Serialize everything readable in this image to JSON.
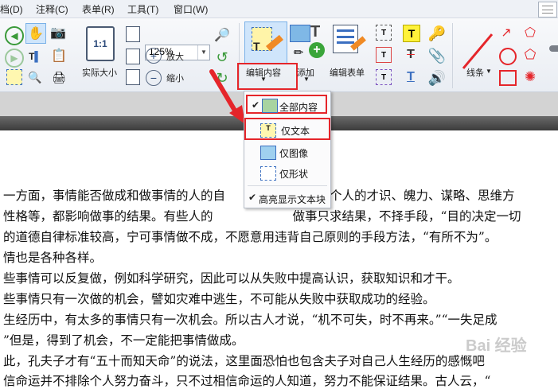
{
  "menubar": {
    "items": [
      "档(D)",
      "注释(C)",
      "表单(R)",
      "工具(T)",
      "窗口(W)"
    ]
  },
  "toolbar": {
    "zoom_value": "125%",
    "actual_size_label": "实际大小",
    "zoom_in_label": "放大",
    "zoom_out_label": "缩小",
    "edit_content_label": "编辑内容",
    "add_label": "添加",
    "edit_form_label": "编辑表单",
    "lines_label": "线条"
  },
  "dropdown": {
    "items": [
      {
        "label": "全部内容",
        "checked": true
      },
      {
        "label": "仅文本",
        "checked": false
      },
      {
        "label": "仅图像",
        "checked": false
      },
      {
        "label": "仅形状",
        "checked": false
      },
      {
        "label": "高亮显示文本块",
        "checked": true
      }
    ]
  },
  "document": {
    "lines": [
      "一方面，事情能否做成和做事情的人的自",
      "性格等，都影响做事的结果。有些人的",
      "的道德自律标准较高，宁可事情做不成，不愿意用违背自己原则的手段方法，“有所不为”。",
      "情也是各种各样。",
      "些事情可以反复做，例如科学研究，因此可以从失败中提高认识，获取知识和才干。",
      "些事情只有一次做的机会，譬如灾难中逃生，不可能从失败中获取成功的经验。",
      "生经历中，有太多的事情只有一次机会。所以古人才说，“机不可失，时不再来。”“一失足成",
      "”但是，得到了机会，不一定能把事情做成。",
      "此，孔夫子才有“五十而知天命”的说法，这里面恐怕也包含夫子对自己人生经历的感慨吧",
      "信命运并不排除个人努力奋斗，只不过相信命运的人知道，努力不能保证结果。古人云，“"
    ],
    "line1_tail": "系。个人的才识、魄力、谋略、思维方",
    "line2_tail": "结果，不择手段，“目的决定一切",
    "line2_mid": "做事只求"
  },
  "watermark": "Bai 经验",
  "colors": {
    "highlight_red": "#e5252a",
    "arrow_red": "#e5252a",
    "check_blue": "#3b7dd8"
  }
}
